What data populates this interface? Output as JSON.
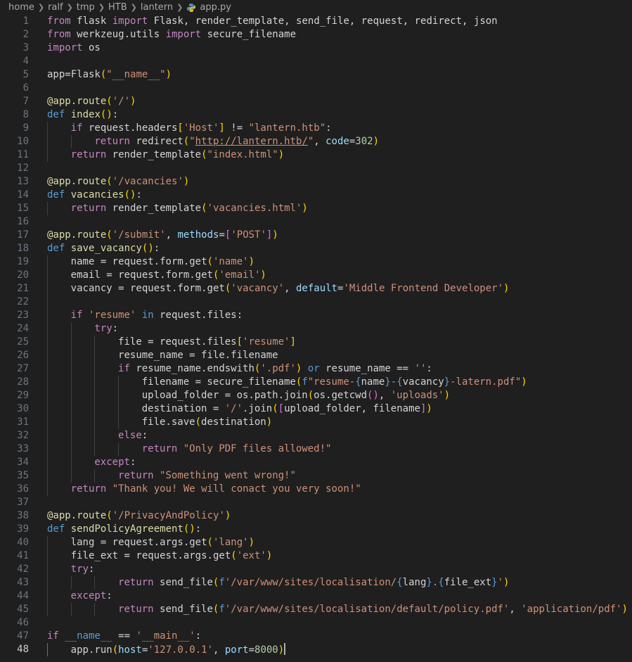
{
  "breadcrumb": {
    "items": [
      "home",
      "ralf",
      "tmp",
      "HTB",
      "lantern"
    ],
    "file": "app.py"
  },
  "colors": {
    "background": "#1f1f1f",
    "keyword": "#c586c0",
    "storage": "#569cd6",
    "function": "#dcdcaa",
    "string": "#ce9178",
    "variable": "#9cdcfe",
    "number": "#b5cea8"
  },
  "editor": {
    "current_line": 48,
    "lines": [
      {
        "n": "1",
        "indent": 0,
        "tokens": [
          [
            "from",
            "kw"
          ],
          [
            " flask ",
            "txt"
          ],
          [
            "import",
            "kw"
          ],
          [
            " Flask, render_template, send_file, request, redirect, json",
            "txt"
          ]
        ]
      },
      {
        "n": "2",
        "indent": 0,
        "tokens": [
          [
            "from",
            "kw"
          ],
          [
            " werkzeug.utils ",
            "txt"
          ],
          [
            "import",
            "kw"
          ],
          [
            " secure_filename",
            "txt"
          ]
        ]
      },
      {
        "n": "3",
        "indent": 0,
        "tokens": [
          [
            "import",
            "kw"
          ],
          [
            " os",
            "txt"
          ]
        ]
      },
      {
        "n": "4",
        "indent": 0,
        "tokens": []
      },
      {
        "n": "5",
        "indent": 0,
        "tokens": [
          [
            "app=Flask",
            "txt"
          ],
          [
            "(",
            "p1"
          ],
          [
            "\"__name__\"",
            "str"
          ],
          [
            ")",
            "p1"
          ]
        ]
      },
      {
        "n": "6",
        "indent": 0,
        "tokens": []
      },
      {
        "n": "7",
        "indent": 0,
        "tokens": [
          [
            "@app.route",
            "fn"
          ],
          [
            "(",
            "p1"
          ],
          [
            "'/'",
            "str"
          ],
          [
            ")",
            "p1"
          ]
        ]
      },
      {
        "n": "8",
        "indent": 0,
        "tokens": [
          [
            "def",
            "key"
          ],
          [
            " ",
            "txt"
          ],
          [
            "index",
            "fn"
          ],
          [
            "()",
            "p1"
          ],
          [
            ":",
            "txt"
          ]
        ]
      },
      {
        "n": "9",
        "indent": 1,
        "tokens": [
          [
            "if",
            "kw"
          ],
          [
            " request.headers",
            "txt"
          ],
          [
            "[",
            "p1"
          ],
          [
            "'Host'",
            "str"
          ],
          [
            "]",
            "p1"
          ],
          [
            " != ",
            "txt"
          ],
          [
            "\"lantern.htb\"",
            "str"
          ],
          [
            ":",
            "txt"
          ]
        ]
      },
      {
        "n": "10",
        "indent": 2,
        "tokens": [
          [
            "return",
            "kw"
          ],
          [
            " redirect",
            "txt"
          ],
          [
            "(",
            "p1"
          ],
          [
            "\"",
            "str"
          ],
          [
            "http://lantern.htb/",
            "link"
          ],
          [
            "\"",
            "str"
          ],
          [
            ", ",
            "txt"
          ],
          [
            "code",
            "var"
          ],
          [
            "=",
            "txt"
          ],
          [
            "302",
            "num"
          ],
          [
            ")",
            "p1"
          ]
        ]
      },
      {
        "n": "11",
        "indent": 1,
        "tokens": [
          [
            "return",
            "kw"
          ],
          [
            " render_template",
            "txt"
          ],
          [
            "(",
            "p1"
          ],
          [
            "\"index.html\"",
            "str"
          ],
          [
            ")",
            "p1"
          ]
        ]
      },
      {
        "n": "12",
        "indent": 0,
        "tokens": []
      },
      {
        "n": "13",
        "indent": 0,
        "tokens": [
          [
            "@app.route",
            "fn"
          ],
          [
            "(",
            "p1"
          ],
          [
            "'/vacancies'",
            "str"
          ],
          [
            ")",
            "p1"
          ]
        ]
      },
      {
        "n": "14",
        "indent": 0,
        "tokens": [
          [
            "def",
            "key"
          ],
          [
            " ",
            "txt"
          ],
          [
            "vacancies",
            "fn"
          ],
          [
            "()",
            "p1"
          ],
          [
            ":",
            "txt"
          ]
        ]
      },
      {
        "n": "15",
        "indent": 1,
        "tokens": [
          [
            "return",
            "kw"
          ],
          [
            " render_template",
            "txt"
          ],
          [
            "(",
            "p1"
          ],
          [
            "'vacancies.html'",
            "str"
          ],
          [
            ")",
            "p1"
          ]
        ]
      },
      {
        "n": "16",
        "indent": 0,
        "tokens": []
      },
      {
        "n": "17",
        "indent": 0,
        "tokens": [
          [
            "@app.route",
            "fn"
          ],
          [
            "(",
            "p1"
          ],
          [
            "'/submit'",
            "str"
          ],
          [
            ", ",
            "txt"
          ],
          [
            "methods",
            "var"
          ],
          [
            "=",
            "txt"
          ],
          [
            "[",
            "p2"
          ],
          [
            "'POST'",
            "str"
          ],
          [
            "]",
            "p2"
          ],
          [
            ")",
            "p1"
          ]
        ]
      },
      {
        "n": "18",
        "indent": 0,
        "tokens": [
          [
            "def",
            "key"
          ],
          [
            " ",
            "txt"
          ],
          [
            "save_vacancy",
            "fn"
          ],
          [
            "()",
            "p1"
          ],
          [
            ":",
            "txt"
          ]
        ]
      },
      {
        "n": "19",
        "indent": 1,
        "tokens": [
          [
            "name = request.form.get",
            "txt"
          ],
          [
            "(",
            "p1"
          ],
          [
            "'name'",
            "str"
          ],
          [
            ")",
            "p1"
          ]
        ]
      },
      {
        "n": "20",
        "indent": 1,
        "tokens": [
          [
            "email = request.form.get",
            "txt"
          ],
          [
            "(",
            "p1"
          ],
          [
            "'email'",
            "str"
          ],
          [
            ")",
            "p1"
          ]
        ]
      },
      {
        "n": "21",
        "indent": 1,
        "tokens": [
          [
            "vacancy = request.form.get",
            "txt"
          ],
          [
            "(",
            "p1"
          ],
          [
            "'vacancy'",
            "str"
          ],
          [
            ", ",
            "txt"
          ],
          [
            "default",
            "var"
          ],
          [
            "=",
            "txt"
          ],
          [
            "'Middle Frontend Developer'",
            "str"
          ],
          [
            ")",
            "p1"
          ]
        ]
      },
      {
        "n": "22",
        "indent": 1,
        "tokens": []
      },
      {
        "n": "23",
        "indent": 1,
        "tokens": [
          [
            "if",
            "kw"
          ],
          [
            " ",
            "txt"
          ],
          [
            "'resume'",
            "str"
          ],
          [
            " ",
            "txt"
          ],
          [
            "in",
            "key"
          ],
          [
            " request.files:",
            "txt"
          ]
        ]
      },
      {
        "n": "24",
        "indent": 2,
        "tokens": [
          [
            "try",
            "kw"
          ],
          [
            ":",
            "txt"
          ]
        ]
      },
      {
        "n": "25",
        "indent": 3,
        "tokens": [
          [
            "file = request.files",
            "txt"
          ],
          [
            "[",
            "p1"
          ],
          [
            "'resume'",
            "str"
          ],
          [
            "]",
            "p1"
          ]
        ]
      },
      {
        "n": "26",
        "indent": 3,
        "tokens": [
          [
            "resume_name = file.filename",
            "txt"
          ]
        ]
      },
      {
        "n": "27",
        "indent": 3,
        "tokens": [
          [
            "if",
            "kw"
          ],
          [
            " resume_name.endswith",
            "txt"
          ],
          [
            "(",
            "p1"
          ],
          [
            "'.pdf'",
            "str"
          ],
          [
            ")",
            "p1"
          ],
          [
            " ",
            "txt"
          ],
          [
            "or",
            "key"
          ],
          [
            " resume_name == ",
            "txt"
          ],
          [
            "''",
            "str"
          ],
          [
            ":",
            "txt"
          ]
        ]
      },
      {
        "n": "28",
        "indent": 4,
        "tokens": [
          [
            "filename = secure_filename",
            "txt"
          ],
          [
            "(",
            "p1"
          ],
          [
            "f",
            "key"
          ],
          [
            "\"resume-",
            "str"
          ],
          [
            "{",
            "esc"
          ],
          [
            "name",
            "txt"
          ],
          [
            "}",
            "esc"
          ],
          [
            "-",
            "str"
          ],
          [
            "{",
            "esc"
          ],
          [
            "vacancy",
            "txt"
          ],
          [
            "}",
            "esc"
          ],
          [
            "-latern.pdf\"",
            "str"
          ],
          [
            ")",
            "p1"
          ]
        ]
      },
      {
        "n": "29",
        "indent": 4,
        "tokens": [
          [
            "upload_folder = os.path.join",
            "txt"
          ],
          [
            "(",
            "p1"
          ],
          [
            "os.getcwd",
            "txt"
          ],
          [
            "()",
            "p2"
          ],
          [
            ", ",
            "txt"
          ],
          [
            "'uploads'",
            "str"
          ],
          [
            ")",
            "p1"
          ]
        ]
      },
      {
        "n": "30",
        "indent": 4,
        "tokens": [
          [
            "destination = ",
            "txt"
          ],
          [
            "'/'",
            "str"
          ],
          [
            ".join",
            "txt"
          ],
          [
            "(",
            "p1"
          ],
          [
            "[",
            "p2"
          ],
          [
            "upload_folder, filename",
            "txt"
          ],
          [
            "]",
            "p2"
          ],
          [
            ")",
            "p1"
          ]
        ]
      },
      {
        "n": "31",
        "indent": 4,
        "tokens": [
          [
            "file.save",
            "txt"
          ],
          [
            "(",
            "p1"
          ],
          [
            "destination",
            "txt"
          ],
          [
            ")",
            "p1"
          ]
        ]
      },
      {
        "n": "32",
        "indent": 3,
        "tokens": [
          [
            "else",
            "kw"
          ],
          [
            ":",
            "txt"
          ]
        ]
      },
      {
        "n": "33",
        "indent": 4,
        "tokens": [
          [
            "return",
            "kw"
          ],
          [
            " ",
            "txt"
          ],
          [
            "\"Only PDF files allowed!\"",
            "str"
          ]
        ]
      },
      {
        "n": "34",
        "indent": 2,
        "tokens": [
          [
            "except",
            "kw"
          ],
          [
            ":",
            "txt"
          ]
        ]
      },
      {
        "n": "35",
        "indent": 3,
        "tokens": [
          [
            "return",
            "kw"
          ],
          [
            " ",
            "txt"
          ],
          [
            "\"Something went wrong!\"",
            "str"
          ]
        ]
      },
      {
        "n": "36",
        "indent": 1,
        "tokens": [
          [
            "return",
            "kw"
          ],
          [
            " ",
            "txt"
          ],
          [
            "\"Thank you! We will conact you very soon!\"",
            "str"
          ]
        ]
      },
      {
        "n": "37",
        "indent": 0,
        "tokens": []
      },
      {
        "n": "38",
        "indent": 0,
        "tokens": [
          [
            "@app.route",
            "fn"
          ],
          [
            "(",
            "p1"
          ],
          [
            "'/PrivacyAndPolicy'",
            "str"
          ],
          [
            ")",
            "p1"
          ]
        ]
      },
      {
        "n": "39",
        "indent": 0,
        "tokens": [
          [
            "def",
            "key"
          ],
          [
            " ",
            "txt"
          ],
          [
            "sendPolicyAgreement",
            "fn"
          ],
          [
            "()",
            "p1"
          ],
          [
            ":",
            "txt"
          ]
        ]
      },
      {
        "n": "40",
        "indent": 1,
        "tokens": [
          [
            "lang = request.args.get",
            "txt"
          ],
          [
            "(",
            "p1"
          ],
          [
            "'lang'",
            "str"
          ],
          [
            ")",
            "p1"
          ]
        ]
      },
      {
        "n": "41",
        "indent": 1,
        "tokens": [
          [
            "file_ext = request.args.get",
            "txt"
          ],
          [
            "(",
            "p1"
          ],
          [
            "'ext'",
            "str"
          ],
          [
            ")",
            "p1"
          ]
        ]
      },
      {
        "n": "42",
        "indent": 1,
        "tokens": [
          [
            "try",
            "kw"
          ],
          [
            ":",
            "txt"
          ]
        ]
      },
      {
        "n": "43",
        "indent": 3,
        "tokens": [
          [
            "return",
            "kw"
          ],
          [
            " send_file",
            "txt"
          ],
          [
            "(",
            "p1"
          ],
          [
            "f",
            "key"
          ],
          [
            "'/var/www/sites/localisation/",
            "str"
          ],
          [
            "{",
            "esc"
          ],
          [
            "lang",
            "txt"
          ],
          [
            "}",
            "esc"
          ],
          [
            ".",
            "str"
          ],
          [
            "{",
            "esc"
          ],
          [
            "file_ext",
            "txt"
          ],
          [
            "}",
            "esc"
          ],
          [
            "'",
            "str"
          ],
          [
            ")",
            "p1"
          ]
        ]
      },
      {
        "n": "44",
        "indent": 1,
        "tokens": [
          [
            "except",
            "kw"
          ],
          [
            ":",
            "txt"
          ]
        ]
      },
      {
        "n": "45",
        "indent": 3,
        "tokens": [
          [
            "return",
            "kw"
          ],
          [
            " send_file",
            "txt"
          ],
          [
            "(",
            "p1"
          ],
          [
            "f",
            "key"
          ],
          [
            "'/var/www/sites/localisation/default/policy.pdf'",
            "str"
          ],
          [
            ", ",
            "txt"
          ],
          [
            "'application/pdf'",
            "str"
          ],
          [
            ")",
            "p1"
          ]
        ]
      },
      {
        "n": "46",
        "indent": 0,
        "tokens": []
      },
      {
        "n": "47",
        "indent": 0,
        "tokens": [
          [
            "if",
            "kw"
          ],
          [
            " ",
            "txt"
          ],
          [
            "__name__",
            "key"
          ],
          [
            " == ",
            "txt"
          ],
          [
            "'__main__'",
            "str"
          ],
          [
            ":",
            "txt"
          ]
        ]
      },
      {
        "n": "48",
        "indent": 1,
        "tokens": [
          [
            "app.run",
            "txt"
          ],
          [
            "(",
            "p1"
          ],
          [
            "host",
            "var"
          ],
          [
            "=",
            "txt"
          ],
          [
            "'127.0.0.1'",
            "str"
          ],
          [
            ", ",
            "txt"
          ],
          [
            "port",
            "var"
          ],
          [
            "=",
            "txt"
          ],
          [
            "8000",
            "num"
          ],
          [
            ")",
            "p1"
          ]
        ]
      }
    ]
  }
}
